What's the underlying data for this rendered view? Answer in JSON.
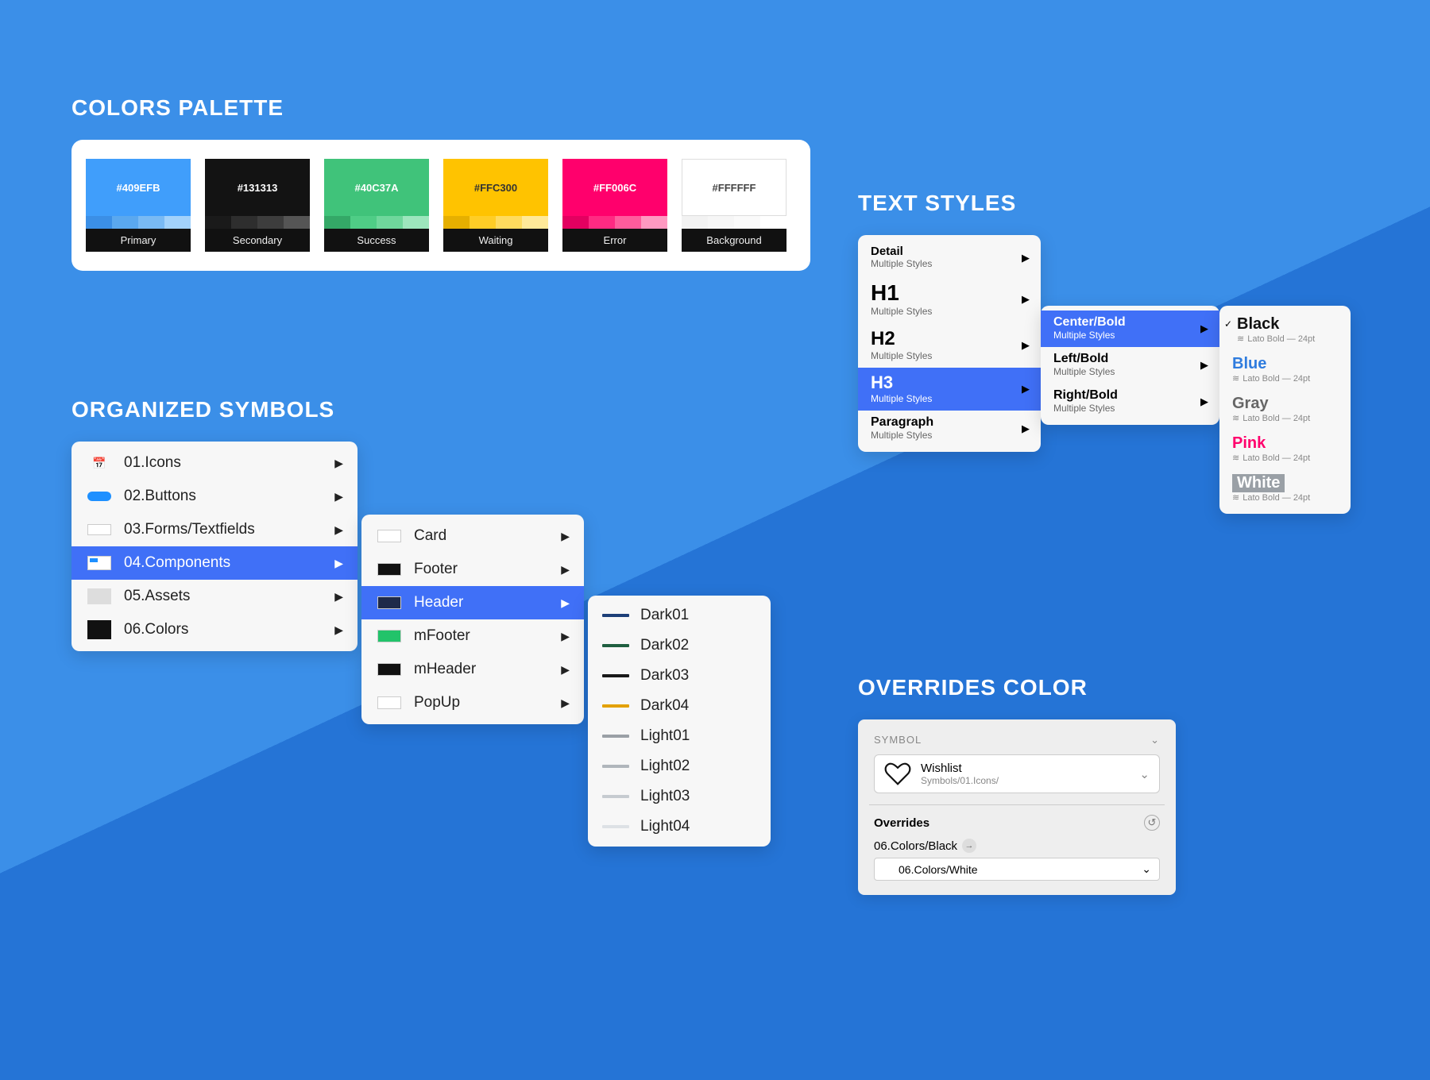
{
  "palette": {
    "title": "COLORS PALETTE",
    "swatches": [
      {
        "hex": "#409EFB",
        "label": "Primary",
        "textColor": "#fff",
        "shades": [
          "#3b8fe6",
          "#5aa8ef",
          "#79baf4",
          "#a2d2fb"
        ]
      },
      {
        "hex": "#131313",
        "label": "Secondary",
        "textColor": "#fff",
        "shades": [
          "#1a1a1a",
          "#2e2e2e",
          "#3d3d3d",
          "#555555"
        ]
      },
      {
        "hex": "#40C37A",
        "label": "Success",
        "textColor": "#fff",
        "shades": [
          "#34a867",
          "#4fcd86",
          "#6fd79c",
          "#9de6bd"
        ]
      },
      {
        "hex": "#FFC300",
        "label": "Waiting",
        "textColor": "#333",
        "shades": [
          "#e6af00",
          "#ffcd26",
          "#ffdb5e",
          "#ffe999"
        ]
      },
      {
        "hex": "#FF006C",
        "label": "Error",
        "textColor": "#fff",
        "shades": [
          "#e30060",
          "#ff2a82",
          "#ff5c9c",
          "#ff99c1"
        ]
      },
      {
        "hex": "#FFFFFF",
        "label": "Background",
        "textColor": "#444",
        "shades": [
          "#f2f2f2",
          "#f6f6f6",
          "#fafafa",
          "#ffffff"
        ],
        "border": true
      }
    ]
  },
  "symbols": {
    "title": "ORGANIZED SYMBOLS",
    "level0": [
      {
        "label": "01.Icons"
      },
      {
        "label": "02.Buttons"
      },
      {
        "label": "03.Forms/Textfields"
      },
      {
        "label": "04.Components",
        "selected": true
      },
      {
        "label": "05.Assets"
      },
      {
        "label": "06.Colors"
      }
    ],
    "level1": [
      {
        "label": "Card"
      },
      {
        "label": "Footer"
      },
      {
        "label": "Header",
        "selected": true
      },
      {
        "label": "mFooter"
      },
      {
        "label": "mHeader"
      },
      {
        "label": "PopUp"
      }
    ],
    "level2": [
      {
        "label": "Dark01",
        "color": "#1d3f78"
      },
      {
        "label": "Dark02",
        "color": "#1f5f40"
      },
      {
        "label": "Dark03",
        "color": "#1a1a1a"
      },
      {
        "label": "Dark04",
        "color": "#e3a100"
      },
      {
        "label": "Light01",
        "color": "#9aa0a6"
      },
      {
        "label": "Light02",
        "color": "#b0b6bc"
      },
      {
        "label": "Light03",
        "color": "#c6cbd0"
      },
      {
        "label": "Light04",
        "color": "#dde1e5"
      }
    ]
  },
  "textStyles": {
    "title": "TEXT STYLES",
    "level0": [
      {
        "title": "Detail",
        "sub": "Multiple Styles",
        "size": "15px"
      },
      {
        "title": "H1",
        "sub": "Multiple Styles",
        "size": "28px"
      },
      {
        "title": "H2",
        "sub": "Multiple Styles",
        "size": "24px"
      },
      {
        "title": "H3",
        "sub": "Multiple Styles",
        "size": "22px",
        "selected": true
      },
      {
        "title": "Paragraph",
        "sub": "Multiple Styles",
        "size": "16px"
      }
    ],
    "level1": [
      {
        "title": "Center/Bold",
        "sub": "Multiple Styles",
        "selected": true
      },
      {
        "title": "Left/Bold",
        "sub": "Multiple Styles"
      },
      {
        "title": "Right/Bold",
        "sub": "Multiple Styles"
      }
    ],
    "level2": [
      {
        "title": "Black",
        "sub": "Lato Bold — 24pt",
        "color": "#111",
        "checked": true
      },
      {
        "title": "Blue",
        "sub": "Lato Bold — 24pt",
        "color": "#2f7cde"
      },
      {
        "title": "Gray",
        "sub": "Lato Bold — 24pt",
        "color": "#666"
      },
      {
        "title": "Pink",
        "sub": "Lato Bold — 24pt",
        "color": "#ff006c"
      },
      {
        "title": "White",
        "sub": "Lato Bold — 24pt",
        "color": "#fff",
        "bg": "#9aa0a6"
      }
    ]
  },
  "overrides": {
    "title": "OVERRIDES COLOR",
    "panel": {
      "symbolLabel": "SYMBOL",
      "name": "Wishlist",
      "path": "Symbols/01.Icons/",
      "overridesLabel": "Overrides",
      "colorPath": "06.Colors/Black",
      "selectValue": "06.Colors/White"
    }
  }
}
